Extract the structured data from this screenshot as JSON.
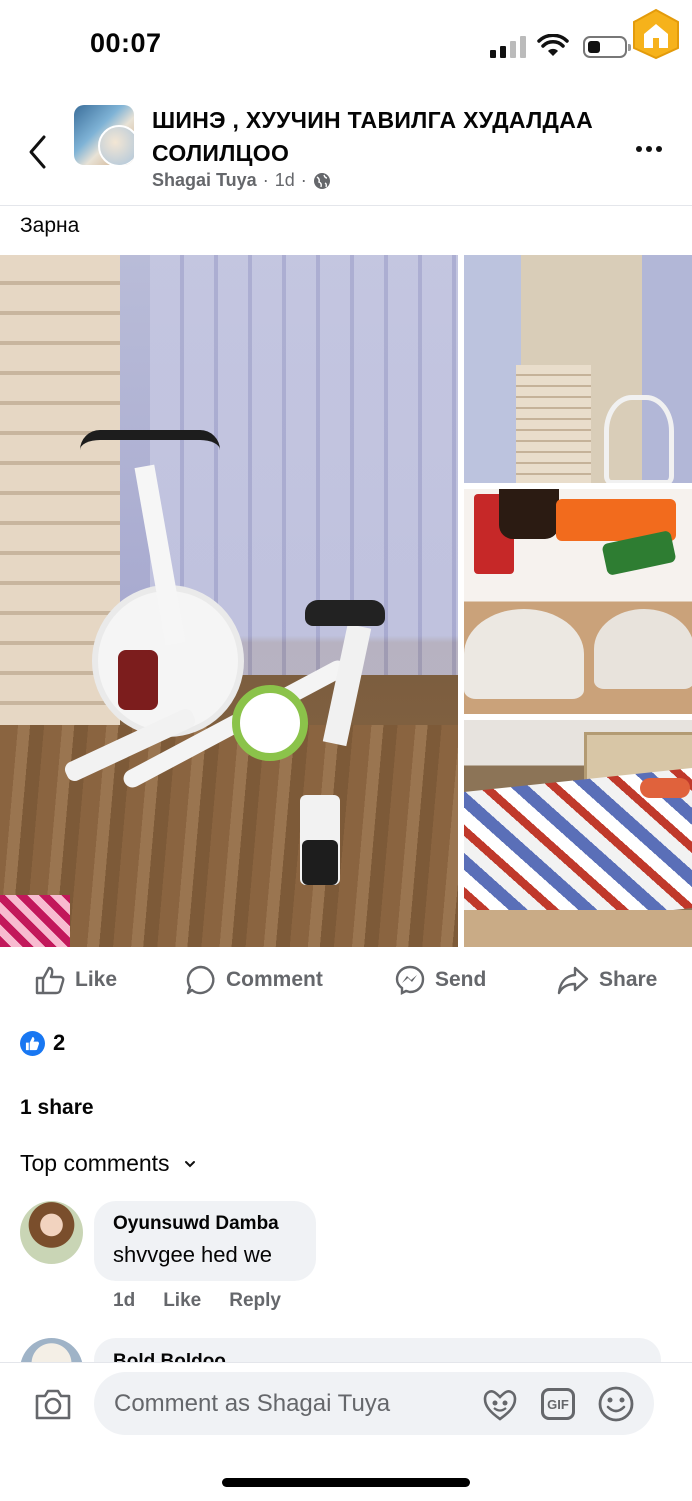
{
  "status_bar": {
    "time": "00:07"
  },
  "header": {
    "group_name": "ШИНЭ , ХУУЧИН ТАВИЛГА ХУДАЛДАА СОЛИЛЦОО",
    "author": "Shagai Tuya",
    "separator": "·",
    "age": "1d"
  },
  "post": {
    "text": "Зарна",
    "photos": [
      "exercise bike",
      "wardrobe with bike",
      "table with groceries",
      "bedroom bed"
    ]
  },
  "actions": {
    "like": "Like",
    "comment": "Comment",
    "send": "Send",
    "share": "Share"
  },
  "stats": {
    "reaction_count": "2",
    "shares": "1 share"
  },
  "comments_section": {
    "sort_label": "Top comments",
    "comments": [
      {
        "author": "Oyunsuwd Damba",
        "text": "shvvgee hed we",
        "age": "1d",
        "like": "Like",
        "reply": "Reply"
      },
      {
        "author": "Bold Boldoo"
      }
    ]
  },
  "composer": {
    "placeholder": "Comment as Shagai Tuya",
    "gif_label": "GIF"
  },
  "colors": {
    "accent": "#1877f2",
    "secondary_text": "#65676b",
    "bubble": "#f0f2f5"
  }
}
